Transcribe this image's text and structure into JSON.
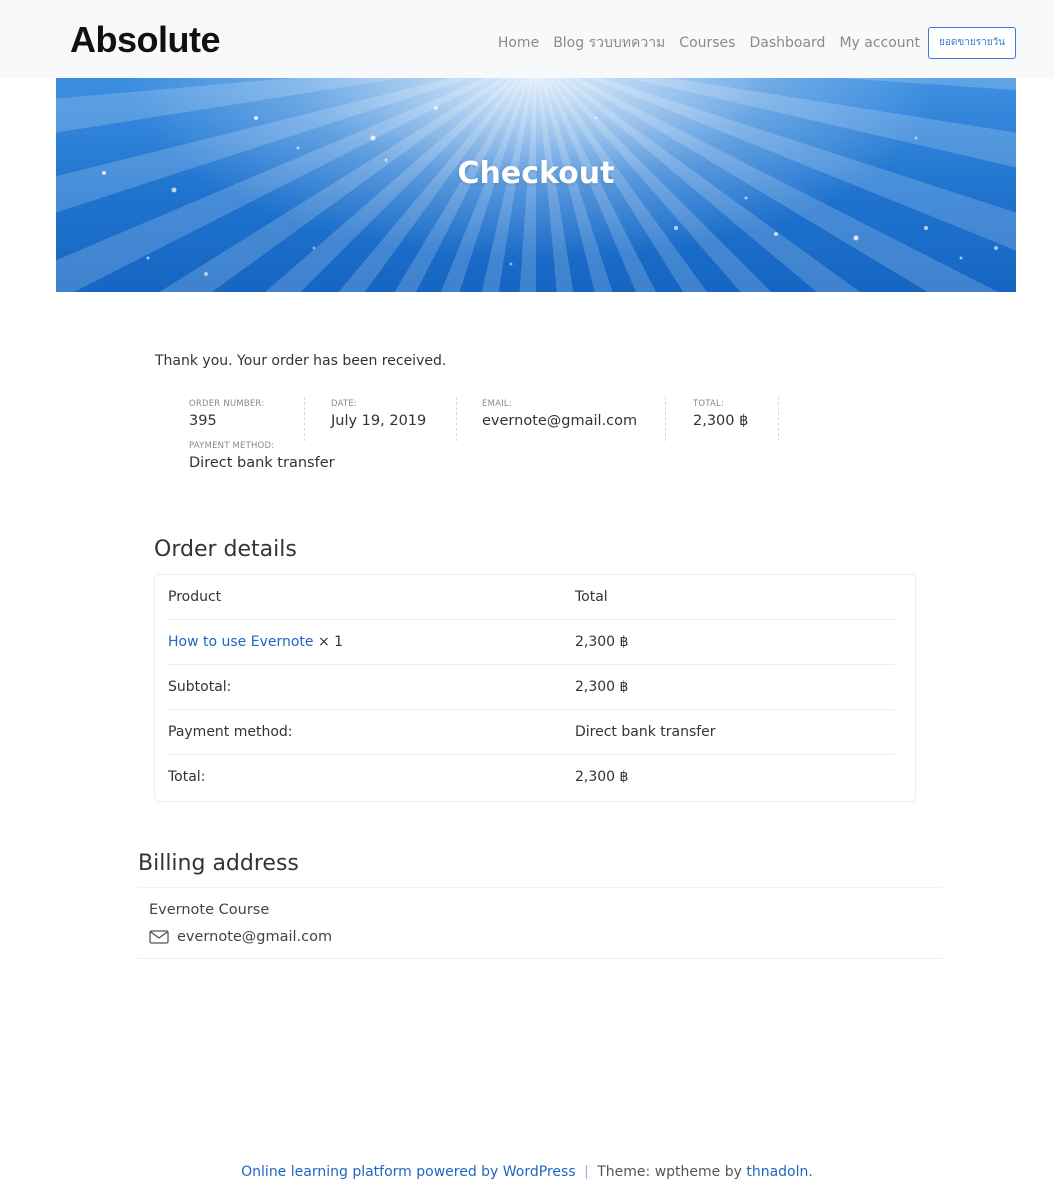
{
  "header": {
    "logo": "Absolute",
    "nav": [
      {
        "label": "Home"
      },
      {
        "label": "Blog รวบบทความ"
      },
      {
        "label": "Courses"
      },
      {
        "label": "Dashboard"
      },
      {
        "label": "My account"
      }
    ],
    "cta_label": "ยอดขายรายวัน"
  },
  "hero": {
    "title": "Checkout"
  },
  "order_received": {
    "message": "Thank you. Your order has been received.",
    "order_number_label": "ORDER NUMBER:",
    "order_number": "395",
    "date_label": "DATE:",
    "date": "July 19, 2019",
    "email_label": "EMAIL:",
    "email": "evernote@gmail.com",
    "total_label": "TOTAL:",
    "total": "2,300 ฿",
    "payment_method_label": "PAYMENT METHOD:",
    "payment_method": "Direct bank transfer"
  },
  "order_details": {
    "title": "Order details",
    "header_product": "Product",
    "header_total": "Total",
    "product_name": "How to use Evernote",
    "product_qty": "× 1",
    "product_total": "2,300 ฿",
    "rows": [
      {
        "label": "Subtotal:",
        "value": "2,300 ฿"
      },
      {
        "label": "Payment method:",
        "value": "Direct bank transfer"
      },
      {
        "label": "Total:",
        "value": "2,300 ฿"
      }
    ]
  },
  "billing": {
    "title": "Billing address",
    "name": "Evernote Course",
    "email": "evernote@gmail.com"
  },
  "footer": {
    "powered_text": "Online learning platform powered by WordPress",
    "separator": "|",
    "theme_text": "Theme: wptheme by",
    "author": "thnadoln."
  },
  "colors": {
    "link": "#1e66c4",
    "hero_blue": "#1f73cf",
    "button_border": "#3a7bd5"
  }
}
